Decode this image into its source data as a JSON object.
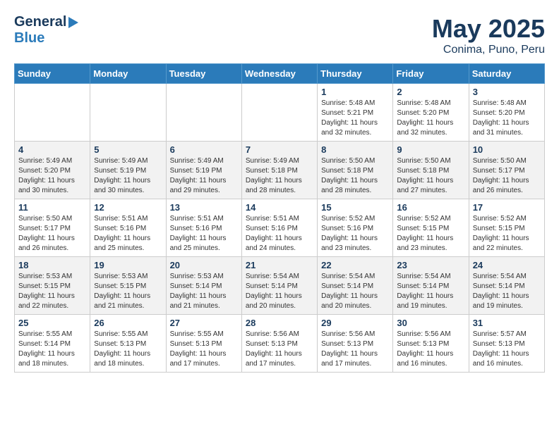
{
  "header": {
    "logo_general": "General",
    "logo_blue": "Blue",
    "month": "May 2025",
    "location": "Conima, Puno, Peru"
  },
  "weekdays": [
    "Sunday",
    "Monday",
    "Tuesday",
    "Wednesday",
    "Thursday",
    "Friday",
    "Saturday"
  ],
  "weeks": [
    [
      {
        "day": "",
        "info": ""
      },
      {
        "day": "",
        "info": ""
      },
      {
        "day": "",
        "info": ""
      },
      {
        "day": "",
        "info": ""
      },
      {
        "day": "1",
        "info": "Sunrise: 5:48 AM\nSunset: 5:21 PM\nDaylight: 11 hours and 32 minutes."
      },
      {
        "day": "2",
        "info": "Sunrise: 5:48 AM\nSunset: 5:20 PM\nDaylight: 11 hours and 32 minutes."
      },
      {
        "day": "3",
        "info": "Sunrise: 5:48 AM\nSunset: 5:20 PM\nDaylight: 11 hours and 31 minutes."
      }
    ],
    [
      {
        "day": "4",
        "info": "Sunrise: 5:49 AM\nSunset: 5:20 PM\nDaylight: 11 hours and 30 minutes."
      },
      {
        "day": "5",
        "info": "Sunrise: 5:49 AM\nSunset: 5:19 PM\nDaylight: 11 hours and 30 minutes."
      },
      {
        "day": "6",
        "info": "Sunrise: 5:49 AM\nSunset: 5:19 PM\nDaylight: 11 hours and 29 minutes."
      },
      {
        "day": "7",
        "info": "Sunrise: 5:49 AM\nSunset: 5:18 PM\nDaylight: 11 hours and 28 minutes."
      },
      {
        "day": "8",
        "info": "Sunrise: 5:50 AM\nSunset: 5:18 PM\nDaylight: 11 hours and 28 minutes."
      },
      {
        "day": "9",
        "info": "Sunrise: 5:50 AM\nSunset: 5:18 PM\nDaylight: 11 hours and 27 minutes."
      },
      {
        "day": "10",
        "info": "Sunrise: 5:50 AM\nSunset: 5:17 PM\nDaylight: 11 hours and 26 minutes."
      }
    ],
    [
      {
        "day": "11",
        "info": "Sunrise: 5:50 AM\nSunset: 5:17 PM\nDaylight: 11 hours and 26 minutes."
      },
      {
        "day": "12",
        "info": "Sunrise: 5:51 AM\nSunset: 5:16 PM\nDaylight: 11 hours and 25 minutes."
      },
      {
        "day": "13",
        "info": "Sunrise: 5:51 AM\nSunset: 5:16 PM\nDaylight: 11 hours and 25 minutes."
      },
      {
        "day": "14",
        "info": "Sunrise: 5:51 AM\nSunset: 5:16 PM\nDaylight: 11 hours and 24 minutes."
      },
      {
        "day": "15",
        "info": "Sunrise: 5:52 AM\nSunset: 5:16 PM\nDaylight: 11 hours and 23 minutes."
      },
      {
        "day": "16",
        "info": "Sunrise: 5:52 AM\nSunset: 5:15 PM\nDaylight: 11 hours and 23 minutes."
      },
      {
        "day": "17",
        "info": "Sunrise: 5:52 AM\nSunset: 5:15 PM\nDaylight: 11 hours and 22 minutes."
      }
    ],
    [
      {
        "day": "18",
        "info": "Sunrise: 5:53 AM\nSunset: 5:15 PM\nDaylight: 11 hours and 22 minutes."
      },
      {
        "day": "19",
        "info": "Sunrise: 5:53 AM\nSunset: 5:15 PM\nDaylight: 11 hours and 21 minutes."
      },
      {
        "day": "20",
        "info": "Sunrise: 5:53 AM\nSunset: 5:14 PM\nDaylight: 11 hours and 21 minutes."
      },
      {
        "day": "21",
        "info": "Sunrise: 5:54 AM\nSunset: 5:14 PM\nDaylight: 11 hours and 20 minutes."
      },
      {
        "day": "22",
        "info": "Sunrise: 5:54 AM\nSunset: 5:14 PM\nDaylight: 11 hours and 20 minutes."
      },
      {
        "day": "23",
        "info": "Sunrise: 5:54 AM\nSunset: 5:14 PM\nDaylight: 11 hours and 19 minutes."
      },
      {
        "day": "24",
        "info": "Sunrise: 5:54 AM\nSunset: 5:14 PM\nDaylight: 11 hours and 19 minutes."
      }
    ],
    [
      {
        "day": "25",
        "info": "Sunrise: 5:55 AM\nSunset: 5:14 PM\nDaylight: 11 hours and 18 minutes."
      },
      {
        "day": "26",
        "info": "Sunrise: 5:55 AM\nSunset: 5:13 PM\nDaylight: 11 hours and 18 minutes."
      },
      {
        "day": "27",
        "info": "Sunrise: 5:55 AM\nSunset: 5:13 PM\nDaylight: 11 hours and 17 minutes."
      },
      {
        "day": "28",
        "info": "Sunrise: 5:56 AM\nSunset: 5:13 PM\nDaylight: 11 hours and 17 minutes."
      },
      {
        "day": "29",
        "info": "Sunrise: 5:56 AM\nSunset: 5:13 PM\nDaylight: 11 hours and 17 minutes."
      },
      {
        "day": "30",
        "info": "Sunrise: 5:56 AM\nSunset: 5:13 PM\nDaylight: 11 hours and 16 minutes."
      },
      {
        "day": "31",
        "info": "Sunrise: 5:57 AM\nSunset: 5:13 PM\nDaylight: 11 hours and 16 minutes."
      }
    ]
  ]
}
